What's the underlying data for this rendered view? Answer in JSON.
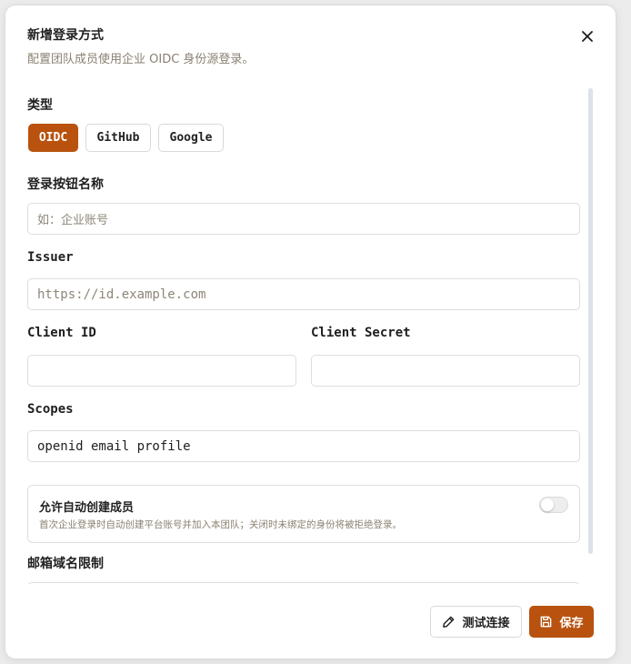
{
  "dialog": {
    "title": "新增登录方式",
    "subtitle": "配置团队成员使用企业 OIDC 身份源登录。",
    "close_icon": "close-icon"
  },
  "form": {
    "type": {
      "label": "类型",
      "options": [
        "OIDC",
        "GitHub",
        "Google"
      ],
      "selected": "OIDC"
    },
    "button_name": {
      "label": "登录按钮名称",
      "placeholder": "如：企业账号",
      "value": ""
    },
    "issuer": {
      "label": "Issuer",
      "placeholder": "https://id.example.com",
      "value": ""
    },
    "client_id": {
      "label": "Client ID",
      "value": ""
    },
    "client_secret": {
      "label": "Client Secret",
      "value": ""
    },
    "scopes": {
      "label": "Scopes",
      "value": "openid email profile"
    },
    "auto_create": {
      "title": "允许自动创建成员",
      "description": "首次企业登录时自动创建平台账号并加入本团队；关闭时未绑定的身份将被拒绝登录。",
      "enabled": false
    },
    "email_domain": {
      "label": "邮箱域名限制",
      "value": ""
    }
  },
  "footer": {
    "test_label": "测试连接",
    "test_icon": "pencil-icon",
    "save_label": "保存",
    "save_icon": "save-icon"
  },
  "colors": {
    "accent": "#b8520e",
    "muted_text": "#8a8172",
    "border": "#dedede"
  }
}
